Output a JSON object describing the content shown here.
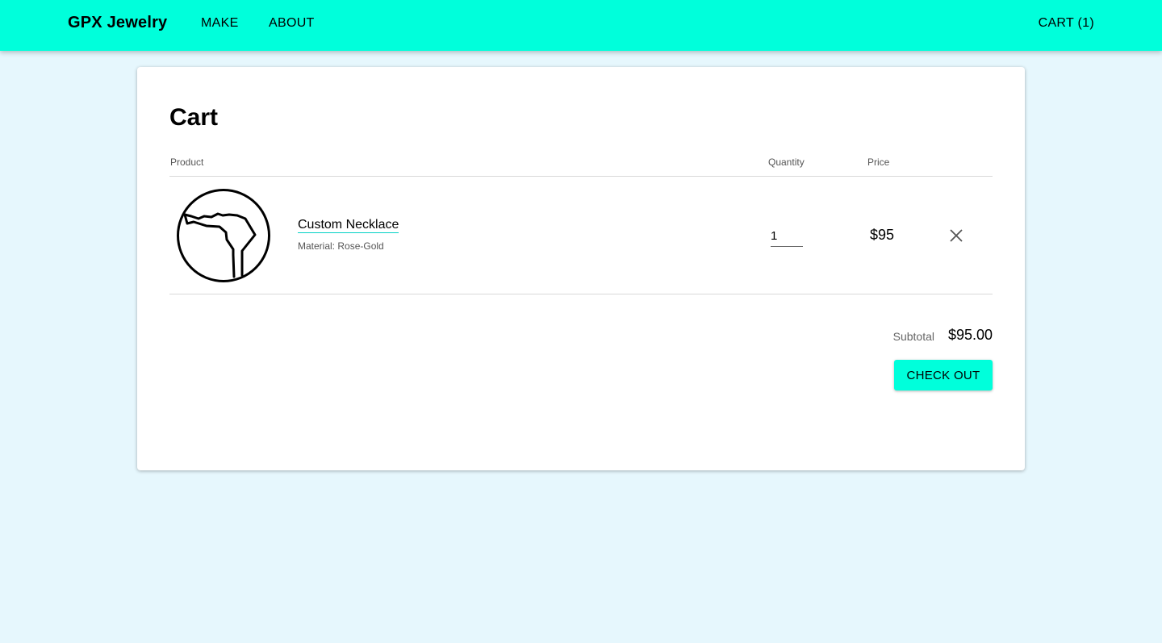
{
  "header": {
    "brand": "GPX Jewelry",
    "nav": {
      "make": "MAKE",
      "about": "ABOUT",
      "cart": "CART (1)"
    }
  },
  "cart": {
    "title": "Cart",
    "columns": {
      "product": "Product",
      "quantity": "Quantity",
      "price": "Price"
    },
    "items": [
      {
        "name": "Custom Necklace",
        "material": "Material: Rose-Gold",
        "quantity": "1",
        "price": "$95",
        "thumbnail_icon": "necklace-route-icon",
        "remove_icon": "close-icon"
      }
    ],
    "subtotal_label": "Subtotal",
    "subtotal_value": "$95.00",
    "checkout_label": "CHECK OUT"
  },
  "colors": {
    "accent": "#00ffdb",
    "background": "#e6f7fd",
    "card": "#ffffff"
  }
}
